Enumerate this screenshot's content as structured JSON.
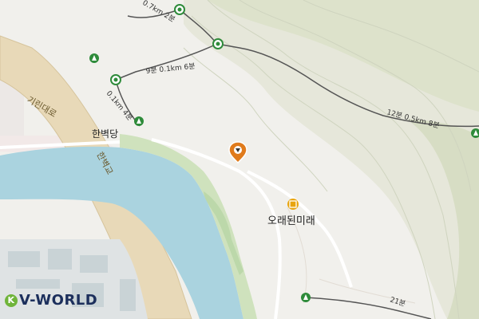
{
  "map": {
    "attribution": "V-WORLD",
    "attribution_mark": "K",
    "road_label": "기린대로",
    "bridge_label": "한벽교",
    "place_label": "한벽당",
    "poi_label": "오래된미래",
    "trail_labels": [
      "0.7km 2분",
      "9분 0.1km 6분",
      "0.1km 4분",
      "12분 0.5km 8분",
      "21분"
    ],
    "colors": {
      "river": "#aad3df",
      "road": "#e8d9b8",
      "park": "#d4e3c4",
      "hill": "#dfe3cf",
      "trail": "#555555",
      "trail_node": "#2e8b3a",
      "marker": "#e07b1c"
    },
    "icons": [
      "trail-node-icon",
      "trail-start-icon",
      "location-pin-icon",
      "poi-icon"
    ]
  }
}
